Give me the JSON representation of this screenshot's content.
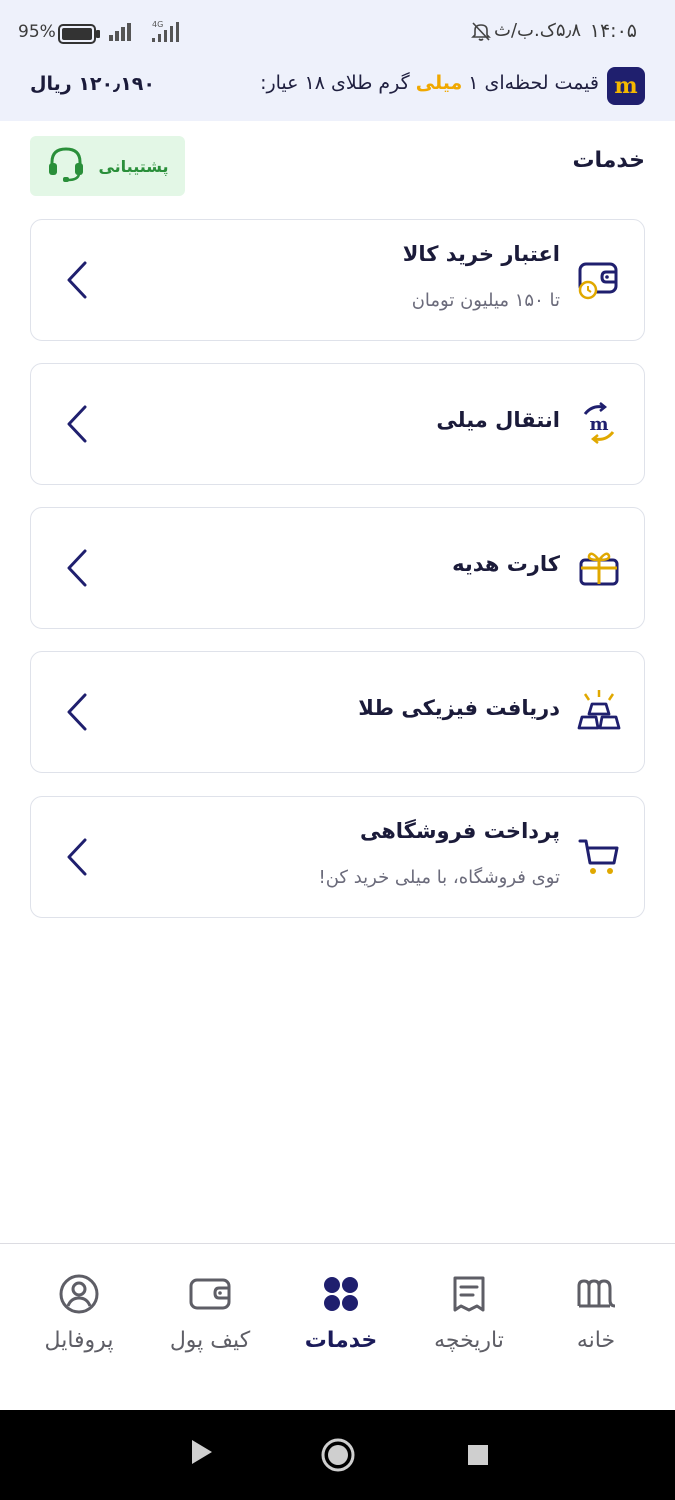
{
  "status_bar": {
    "time": "۱۴:۰۵",
    "network_speed": "۵٫۸ک.ب/ث",
    "battery_percent": "95%",
    "network_type": "4G"
  },
  "price_banner": {
    "logo_letter": "m",
    "text_before": "قیمت لحظه‌ای ۱ ",
    "text_highlight": "میلی",
    "text_after": " گرم طلای ۱۸ عیار:",
    "price": "۱۲۰٫۱۹۰ ریال",
    "highlight_color": "#f0a800"
  },
  "header": {
    "title": "خدمات",
    "support_label": "پشتیبانی"
  },
  "services": [
    {
      "title": "اعتبار خرید کالا",
      "subtitle": "تا ۱۵۰ میلیون تومان",
      "icon": "wallet-clock-icon"
    },
    {
      "title": "انتقال میلی",
      "subtitle": "",
      "icon": "transfer-icon"
    },
    {
      "title": "کارت هدیه",
      "subtitle": "",
      "icon": "gift-icon"
    },
    {
      "title": "دریافت فیزیکی طلا",
      "subtitle": "",
      "icon": "gold-bars-icon"
    },
    {
      "title": "پرداخت فروشگاهی",
      "subtitle": "توی فروشگاه، با میلی خرید کن!",
      "icon": "cart-icon"
    }
  ],
  "bottom_nav": {
    "items": [
      {
        "label": "خانه",
        "icon": "home-logo-icon"
      },
      {
        "label": "تاریخچه",
        "icon": "receipt-icon"
      },
      {
        "label": "خدمات",
        "icon": "grid-icon",
        "active": true
      },
      {
        "label": "کیف پول",
        "icon": "wallet-icon"
      },
      {
        "label": "پروفایل",
        "icon": "profile-icon"
      }
    ]
  },
  "colors": {
    "primary": "#1f1f6e",
    "accent": "#f5b800",
    "support_green": "#2a8f3a"
  }
}
